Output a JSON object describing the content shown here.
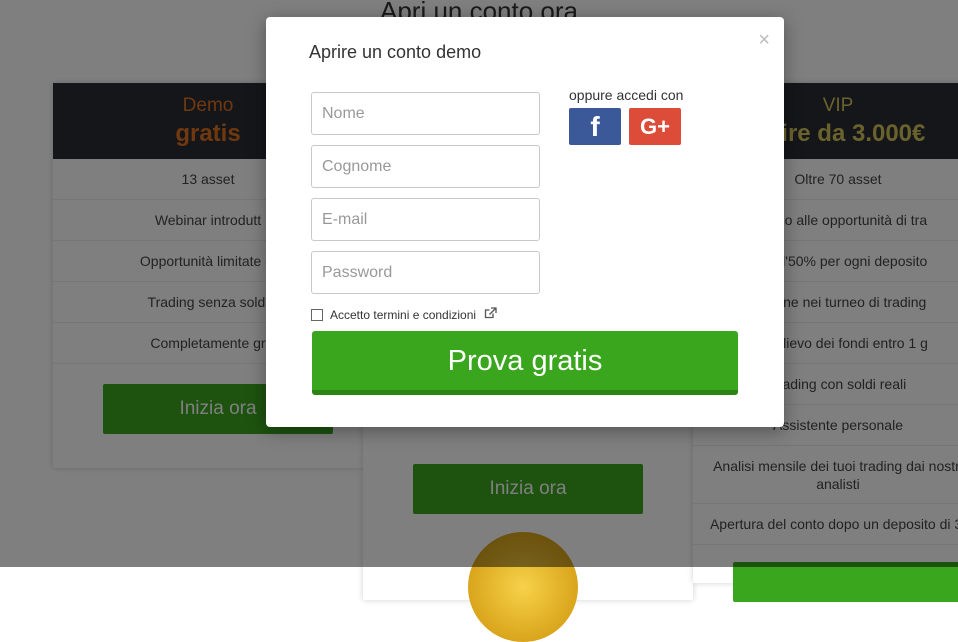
{
  "page": {
    "title": "Apri un conto ora"
  },
  "plans": {
    "demo": {
      "name": "Demo",
      "price": "gratis",
      "features": [
        "13 asset",
        "Webinar introdutt",
        "Opportunità limitate di",
        "Trading senza soldi",
        "Completamente gr"
      ],
      "cta": "Inizia ora"
    },
    "middle": {
      "cta": "Inizia ora"
    },
    "vip": {
      "name": "VIP",
      "price": "artire da 3.000€",
      "features": [
        "Oltre 70 asset",
        "ccesso alle opportunità di tra",
        "ino all'50% per ogni deposito",
        "pazione nei turneo di trading",
        "el prelievo dei fondi entro 1 g",
        "Trading con soldi reali",
        "Assistente personale",
        "Analisi mensile dei tuoi trading dai nostri analisti",
        "Apertura del conto dopo un deposito di 3."
      ]
    }
  },
  "modal": {
    "title": "Aprire un conto demo",
    "close": "×",
    "fields": {
      "first_name": "Nome",
      "last_name": "Cognome",
      "email": "E-mail",
      "password": "Password"
    },
    "social_label": "oppure accedi con",
    "social": {
      "facebook": "f",
      "google": "G+"
    },
    "terms_label": "Accetto termini e condizioni",
    "submit": "Prova gratis"
  },
  "colors": {
    "accent_green": "#3aa61e",
    "demo_orange": "#e0701f",
    "vip_gold": "#d4c45a",
    "card_head": "#2b2c33",
    "facebook": "#3b5998",
    "google": "#dd4b39"
  }
}
